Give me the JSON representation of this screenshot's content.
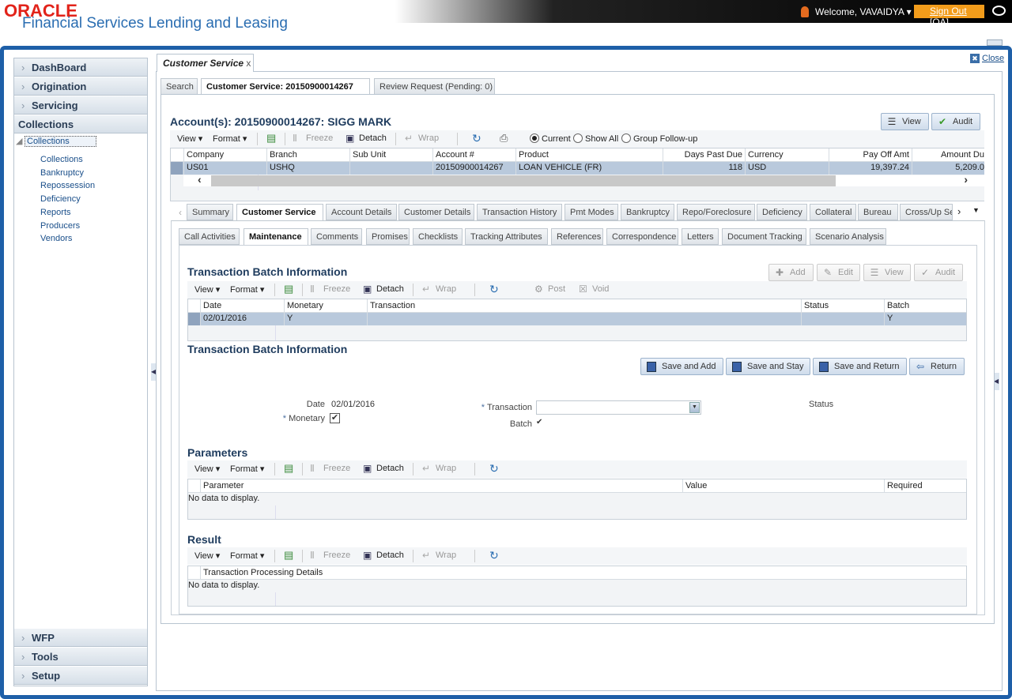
{
  "header": {
    "logo": "ORACLE",
    "app_title": "Financial Services Lending and Leasing",
    "welcome": "Welcome, VAVAIDYA ▾",
    "sign_out": "Sign Out [QA]"
  },
  "sidebar": {
    "top_items": [
      {
        "label": "DashBoard"
      },
      {
        "label": "Origination"
      },
      {
        "label": "Servicing"
      },
      {
        "label": "Collections"
      }
    ],
    "tree_root": "Collections",
    "tree_items": [
      "Collections",
      "Bankruptcy",
      "Repossession",
      "Deficiency",
      "Reports",
      "Producers",
      "Vendors"
    ],
    "bottom_items": [
      {
        "label": "WFP"
      },
      {
        "label": "Tools"
      },
      {
        "label": "Setup"
      }
    ]
  },
  "main": {
    "tab_label": "Customer Service",
    "tab_close": "x",
    "close_label": "Close",
    "page_tabs": [
      "Search",
      "Customer Service: 20150900014267",
      "Review Request (Pending: 0)"
    ],
    "account_title": "Account(s): 20150900014267: SIGG MARK",
    "view_label": "View",
    "audit_label": "Audit",
    "account_toolbar": {
      "view": "View ▾",
      "format": "Format ▾",
      "freeze": "Freeze",
      "detach": "Detach",
      "wrap": "Wrap",
      "radios": [
        {
          "label": "Current",
          "checked": true
        },
        {
          "label": "Show All",
          "checked": false
        },
        {
          "label": "Group Follow-up",
          "checked": false
        }
      ]
    },
    "account_table": {
      "columns": [
        "Company",
        "Branch",
        "Sub Unit",
        "Account #",
        "Product",
        "Days Past Due",
        "Currency",
        "Pay Off Amt",
        "Amount Du"
      ],
      "rows": [
        [
          "US01",
          "USHQ",
          "",
          "20150900014267",
          "LOAN VEHICLE (FR)",
          "118",
          "USD",
          "19,397.24",
          "5,209.0"
        ]
      ]
    },
    "section_tabs": [
      "Summary",
      "Customer Service",
      "Account Details",
      "Customer Details",
      "Transaction History",
      "Pmt Modes",
      "Bankruptcy",
      "Repo/Foreclosure",
      "Deficiency",
      "Collateral",
      "Bureau",
      "Cross/Up Se"
    ],
    "sub_tabs": [
      "Call Activities",
      "Maintenance",
      "Comments",
      "Promises",
      "Checklists",
      "Tracking Attributes",
      "References",
      "Correspondence",
      "Letters",
      "Document Tracking",
      "Scenario Analysis"
    ]
  },
  "batch": {
    "title": "Transaction Batch Information",
    "buttons": [
      "Add",
      "Edit",
      "View",
      "Audit"
    ],
    "toolbar": {
      "view": "View ▾",
      "format": "Format ▾",
      "freeze": "Freeze",
      "detach": "Detach",
      "wrap": "Wrap",
      "post": "Post",
      "void": "Void"
    },
    "table": {
      "columns": [
        "Date",
        "Monetary",
        "Transaction",
        "Status",
        "Batch"
      ],
      "rows": [
        [
          "02/01/2016",
          "Y",
          "",
          "",
          "Y"
        ]
      ]
    }
  },
  "form": {
    "title": "Transaction Batch Information",
    "buttons": [
      "Save and Add",
      "Save and Stay",
      "Save and Return",
      "Return"
    ],
    "date_label": "Date",
    "date_value": "02/01/2016",
    "monetary_label": "Monetary",
    "monetary_checked": true,
    "transaction_label": "Transaction",
    "transaction_value": "",
    "batch_label": "Batch",
    "batch_value": "✔",
    "status_label": "Status",
    "required_mark": "*"
  },
  "parameters": {
    "title": "Parameters",
    "columns": [
      "Parameter",
      "Value",
      "Required"
    ],
    "empty": "No data to display."
  },
  "result": {
    "title": "Result",
    "columns": [
      "Transaction Processing Details"
    ],
    "empty": "No data to display."
  },
  "colors": {
    "accent": "#1e5fa8",
    "selected_row": "#b9c9dc",
    "signout": "#f29c1b",
    "oracle_red": "#e2231a"
  }
}
